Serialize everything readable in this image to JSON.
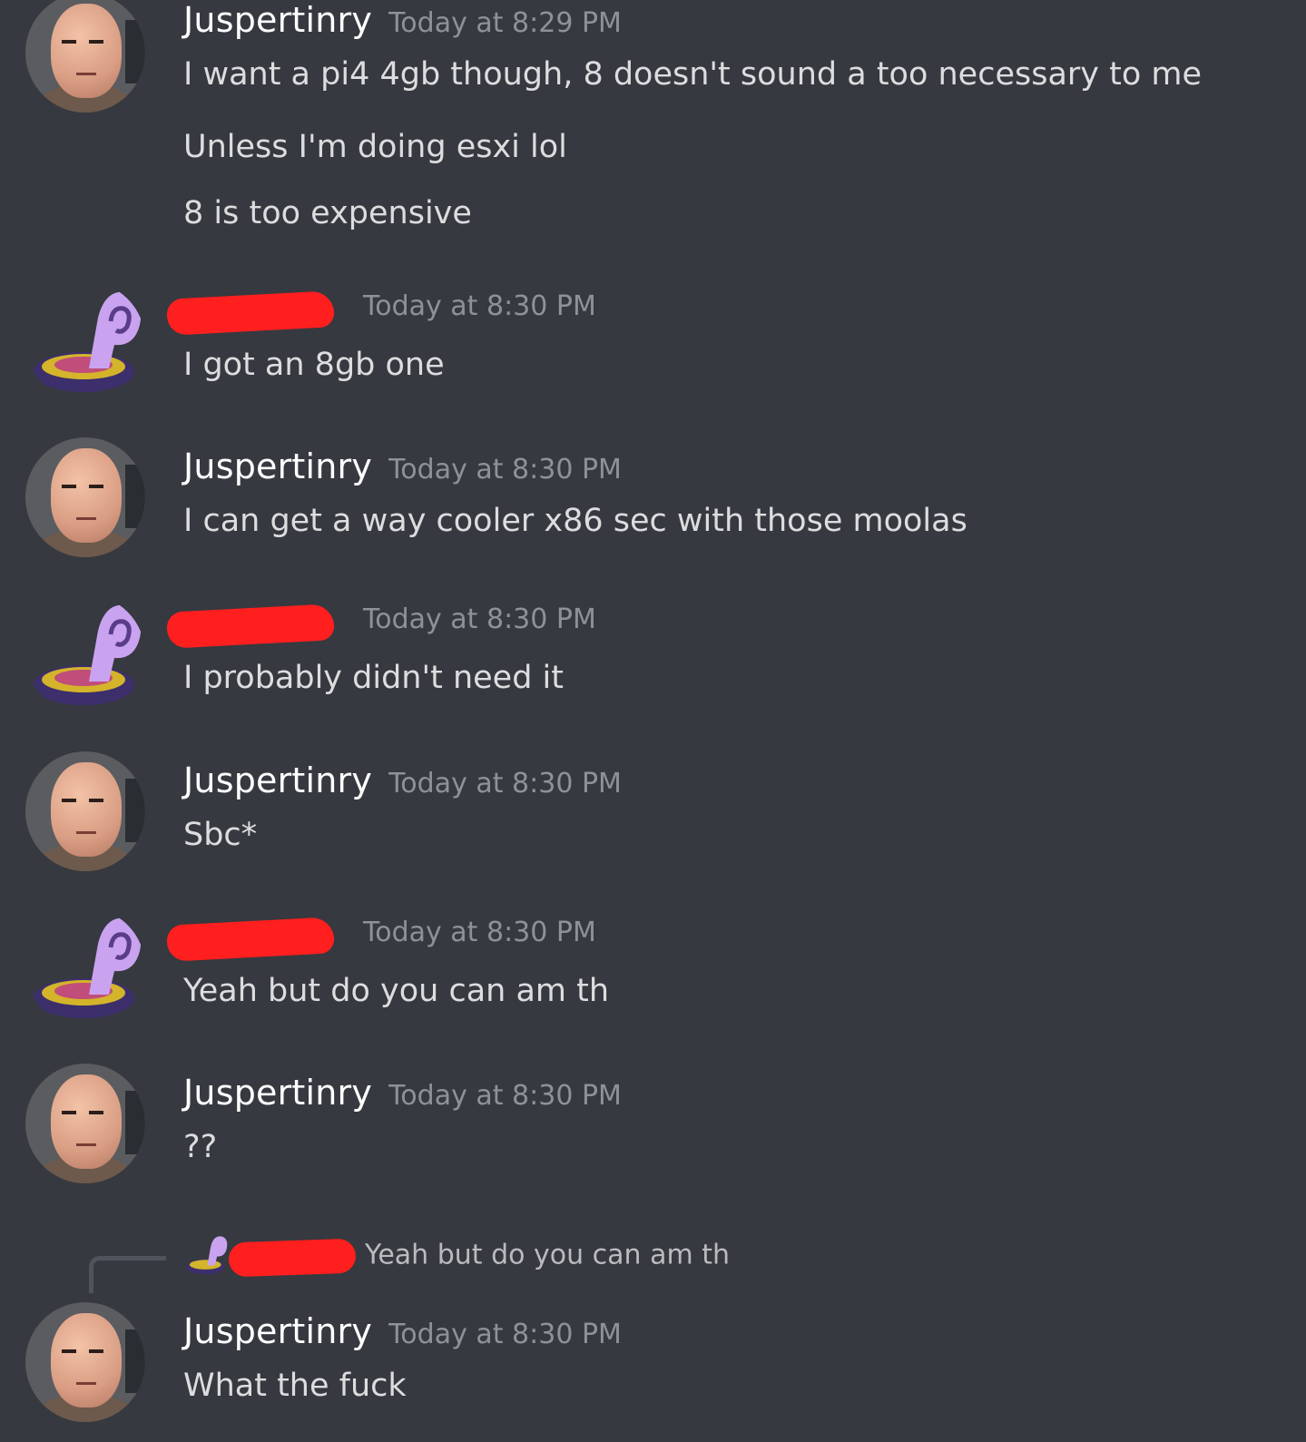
{
  "messages": [
    {
      "author": "Juspertinry",
      "timestamp": "Today at 8:29 PM",
      "lines": [
        "I want a pi4 4gb though, 8 doesn't sound a too necessary to me",
        "Unless I'm doing esxi lol",
        "8 is too expensive"
      ]
    },
    {
      "author": "",
      "author_redacted": true,
      "timestamp": "Today at 8:30 PM",
      "lines": [
        "I got an 8gb one"
      ]
    },
    {
      "author": "Juspertinry",
      "timestamp": "Today at 8:30 PM",
      "lines": [
        "I can get a way cooler x86 sec with those moolas"
      ]
    },
    {
      "author": "",
      "author_redacted": true,
      "timestamp": "Today at 8:30 PM",
      "lines": [
        "I probably didn't need it"
      ]
    },
    {
      "author": "Juspertinry",
      "timestamp": "Today at 8:30 PM",
      "lines": [
        "Sbc*"
      ]
    },
    {
      "author": "",
      "author_redacted": true,
      "timestamp": "Today at 8:30 PM",
      "lines": [
        "Yeah but do you can am th"
      ]
    },
    {
      "author": "Juspertinry",
      "timestamp": "Today at 8:30 PM",
      "lines": [
        "??"
      ]
    },
    {
      "author": "Juspertinry",
      "timestamp": "Today at 8:30 PM",
      "reply_to": {
        "author_redacted": true,
        "text": "Yeah but do you can am th"
      },
      "lines": [
        "What the fuck"
      ]
    }
  ],
  "colors": {
    "background": "#36393f",
    "username": "#ffffff",
    "timestamp": "#8e9297",
    "message_text": "#dcddde",
    "redaction": "#ff1f1f"
  }
}
